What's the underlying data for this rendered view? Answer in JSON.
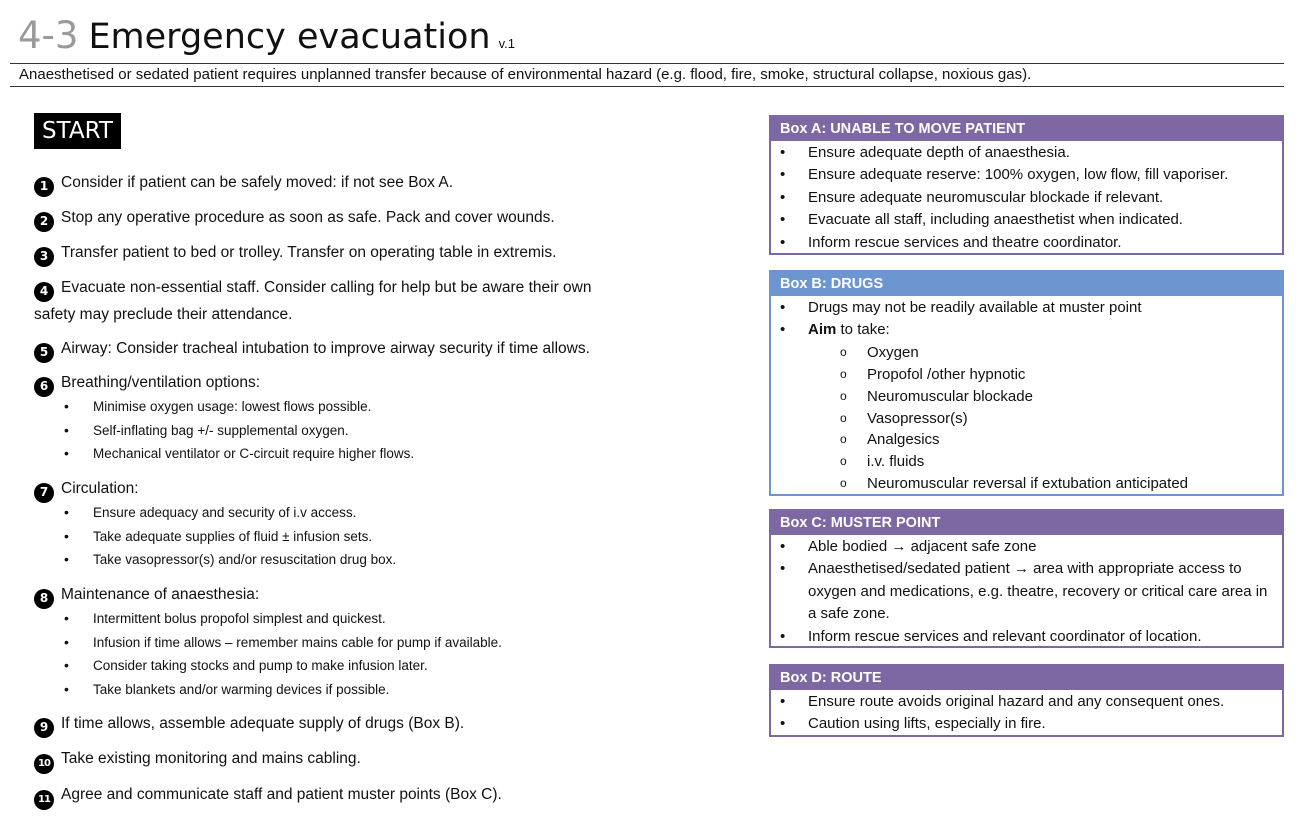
{
  "header": {
    "code": "4-3",
    "title": "Emergency evacuation",
    "version": "v.1",
    "subtitle": "Anaesthetised or sedated patient requires unplanned transfer because of environmental hazard (e.g. flood, fire, smoke, structural collapse, noxious gas)."
  },
  "start_label": "START",
  "steps": [
    {
      "num": "1",
      "text": "Consider if patient can be safely moved: if not see Box A."
    },
    {
      "num": "2",
      "text": "Stop any operative procedure as soon as safe.  Pack and cover wounds."
    },
    {
      "num": "3",
      "text": "Transfer patient to bed or trolley. Transfer on operating table in extremis."
    },
    {
      "num": "4",
      "text": "Evacuate non-essential staff. Consider calling for help but be aware their own safety may preclude their attendance."
    },
    {
      "num": "5",
      "text": "Airway: Consider tracheal intubation to improve airway security if time allows."
    },
    {
      "num": "6",
      "text": "Breathing/ventilation options:",
      "items": [
        "Minimise oxygen usage: lowest flows possible.",
        "Self-inflating bag +/- supplemental oxygen.",
        "Mechanical ventilator or C-circuit require higher flows."
      ]
    },
    {
      "num": "7",
      "text": "Circulation:",
      "items": [
        "Ensure adequacy and security of i.v access.",
        "Take adequate supplies of fluid ± infusion sets.",
        "Take vasopressor(s) and/or resuscitation drug box."
      ]
    },
    {
      "num": "8",
      "text": "Maintenance of anaesthesia:",
      "items": [
        "Intermittent bolus propofol simplest and quickest.",
        "Infusion if time allows – remember mains cable for pump if available.",
        "Consider taking stocks and pump to make infusion later.",
        "Take blankets and/or warming devices if possible."
      ]
    },
    {
      "num": "9",
      "text": "If time allows, assemble adequate supply of drugs (Box B)."
    },
    {
      "num": "10",
      "text": "Take existing monitoring and mains cabling."
    },
    {
      "num": "11",
      "text": "Agree and communicate staff and patient muster points (Box C)."
    }
  ],
  "boxes": {
    "a": {
      "title": "Box A: UNABLE TO MOVE PATIENT",
      "items": [
        "Ensure adequate depth of anaesthesia.",
        "Ensure adequate reserve: 100% oxygen, low flow, fill vaporiser.",
        "Ensure adequate neuromuscular blockade if relevant.",
        "Evacuate all staff, including anaesthetist when indicated.",
        "Inform rescue services and theatre coordinator."
      ]
    },
    "b": {
      "title": "Box B: DRUGS",
      "items": [
        "Drugs may not be readily available at muster point"
      ],
      "aim_bold": "Aim",
      "aim_rest": " to take:",
      "drugs": [
        "Oxygen",
        "Propofol /other hypnotic",
        "Neuromuscular blockade",
        "Vasopressor(s)",
        "Analgesics",
        "i.v. fluids",
        "Neuromuscular reversal if extubation anticipated"
      ]
    },
    "c": {
      "title": "Box C: MUSTER POINT",
      "items": [
        "Able bodied → adjacent safe zone",
        "Anaesthetised/sedated patient → area with appropriate access to oxygen and medications, e.g. theatre, recovery or critical care area in a safe zone.",
        "Inform rescue services and relevant coordinator of location."
      ]
    },
    "d": {
      "title": "Box D: ROUTE",
      "items": [
        "Ensure route avoids original hazard and any consequent ones.",
        "Caution using lifts, especially in fire."
      ]
    }
  },
  "colors": {
    "purple_box": "#7e68a3",
    "blue_box": "#6d95cf",
    "code_grey": "#9a9a9a"
  }
}
